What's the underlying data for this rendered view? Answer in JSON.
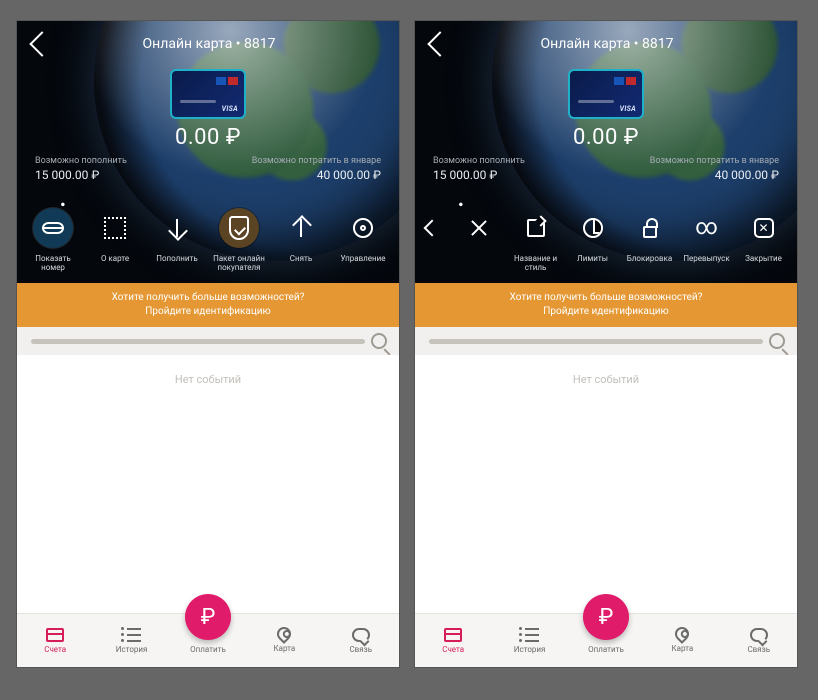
{
  "header": {
    "title": "Онлайн карта • 8817"
  },
  "card": {
    "brand": "VISA",
    "balance": "0.00 ₽"
  },
  "limits": {
    "topup_label": "Возможно пополнить",
    "topup_value": "15 000.00 ₽",
    "spend_label": "Возможно потратить в январе",
    "spend_value": "40 000.00 ₽"
  },
  "actions_left": {
    "a1": "Показать номер",
    "a2": "О карте",
    "a3": "Пополнить",
    "a4": "Пакет онлайн покупателя",
    "a5": "Снять",
    "a6": "Управление"
  },
  "actions_right": {
    "a1": "",
    "a2": "",
    "a3": "Название и стиль",
    "a4": "Лимиты",
    "a5": "Блокировка",
    "a6": "Перевыпуск",
    "a7": "Закрытие"
  },
  "banner": {
    "line1": "Хотите получить больше возможностей?",
    "line2": "Пройдите идентификацию"
  },
  "content": {
    "empty": "Нет событий"
  },
  "nav": {
    "t1": "Счета",
    "t2": "История",
    "t3": "Оплатить",
    "t4": "Карта",
    "t5": "Связь",
    "fab": "₽"
  }
}
